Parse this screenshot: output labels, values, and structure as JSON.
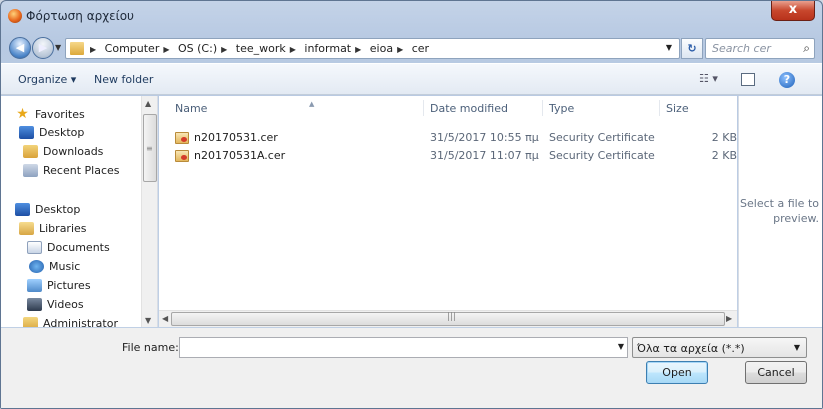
{
  "window": {
    "title": "Φόρτωση αρχείου",
    "close_label": "x"
  },
  "address": {
    "crumbs": [
      "Computer",
      "OS (C:)",
      "tee_work",
      "informat",
      "eioa",
      "cer"
    ],
    "search_placeholder": "Search cer",
    "refresh_glyph": "↻"
  },
  "toolbar": {
    "organize_label": "Organize ▾",
    "new_folder_label": "New folder",
    "view_glyph": "☷ ▾",
    "help_glyph": "?"
  },
  "nav": {
    "items": [
      {
        "label": "Favorites",
        "icon": "star-icon"
      },
      {
        "label": "Desktop",
        "icon": "desktop-icon"
      },
      {
        "label": "Downloads",
        "icon": "downloads-icon"
      },
      {
        "label": "Recent Places",
        "icon": "recent-places-icon"
      },
      {
        "label": "Desktop",
        "icon": "desktop-icon"
      },
      {
        "label": "Libraries",
        "icon": "libraries-icon"
      },
      {
        "label": "Documents",
        "icon": "documents-icon"
      },
      {
        "label": "Music",
        "icon": "music-icon"
      },
      {
        "label": "Pictures",
        "icon": "pictures-icon"
      },
      {
        "label": "Videos",
        "icon": "videos-icon"
      },
      {
        "label": "Administrator",
        "icon": "user-folder-icon"
      }
    ]
  },
  "columns": {
    "name": "Name",
    "date": "Date modified",
    "type": "Type",
    "size": "Size"
  },
  "files": [
    {
      "name": "n20170531.cer",
      "date": "31/5/2017 10:55 πμ",
      "type": "Security Certificate",
      "size": "2 KB"
    },
    {
      "name": "n20170531A.cer",
      "date": "31/5/2017 11:07 πμ",
      "type": "Security Certificate",
      "size": "2 KB"
    }
  ],
  "preview": {
    "text": "Select a file to preview."
  },
  "bottom": {
    "file_name_label": "File name:",
    "file_name_value": "",
    "filter_value": "Όλα τα αρχεία (*.*)",
    "open_label": "Open",
    "cancel_label": "Cancel"
  }
}
